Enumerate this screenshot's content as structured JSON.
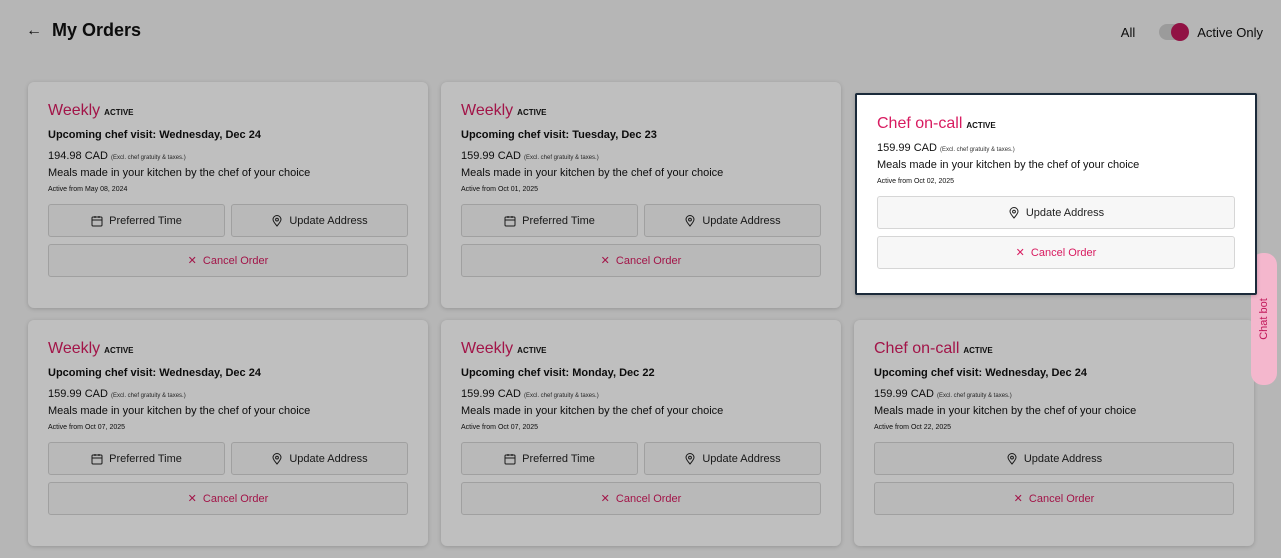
{
  "header": {
    "back_icon": "arrow-left-icon",
    "title": "My Orders"
  },
  "filter": {
    "all_label": "All",
    "active_only_label": "Active Only"
  },
  "orders": [
    {
      "plan": "Weekly",
      "badge": "ACTIVE",
      "visit": "Upcoming chef visit: Wednesday, Dec 24",
      "price": "194.98 CAD",
      "excl": "(Excl. chef gratuity & taxes.)",
      "desc": "Meals made in your kitchen by the chef of your choice",
      "since": "Active from May 08, 2024",
      "preferred_time": "Preferred Time",
      "update_address": "Update Address",
      "cancel": "Cancel Order"
    },
    {
      "plan": "Weekly",
      "badge": "ACTIVE",
      "visit": "Upcoming chef visit: Tuesday, Dec 23",
      "price": "159.99 CAD",
      "excl": "(Excl. chef gratuity & taxes.)",
      "desc": "Meals made in your kitchen by the chef of your choice",
      "since": "Active from Oct 01, 2025",
      "preferred_time": "Preferred Time",
      "update_address": "Update Address",
      "cancel": "Cancel Order"
    },
    {
      "plan": "Chef on-call",
      "badge": "ACTIVE",
      "price": "159.99 CAD",
      "excl": "(Excl. chef gratuity & taxes.)",
      "desc": "Meals made in your kitchen by the chef of your choice",
      "since": "Active from Oct 02, 2025",
      "update_address": "Update Address",
      "cancel": "Cancel Order"
    },
    {
      "plan": "Weekly",
      "badge": "ACTIVE",
      "visit": "Upcoming chef visit: Wednesday, Dec 24",
      "price": "159.99 CAD",
      "excl": "(Excl. chef gratuity & taxes.)",
      "desc": "Meals made in your kitchen by the chef of your choice",
      "since": "Active from Oct 07, 2025",
      "preferred_time": "Preferred Time",
      "update_address": "Update Address",
      "cancel": "Cancel Order"
    },
    {
      "plan": "Weekly",
      "badge": "ACTIVE",
      "visit": "Upcoming chef visit: Monday, Dec 22",
      "price": "159.99 CAD",
      "excl": "(Excl. chef gratuity & taxes.)",
      "desc": "Meals made in your kitchen by the chef of your choice",
      "since": "Active from Oct 07, 2025",
      "preferred_time": "Preferred Time",
      "update_address": "Update Address",
      "cancel": "Cancel Order"
    },
    {
      "plan": "Chef on-call",
      "badge": "ACTIVE",
      "visit": "Upcoming chef visit: Wednesday, Dec 24",
      "price": "159.99 CAD",
      "excl": "(Excl. chef gratuity & taxes.)",
      "desc": "Meals made in your kitchen by the chef of your choice",
      "since": "Active from Oct 22, 2025",
      "update_address": "Update Address",
      "cancel": "Cancel Order"
    }
  ],
  "chatbot": {
    "label": "Chat bot"
  },
  "colors": {
    "accent": "#d81b60",
    "overlay": "rgba(0,0,0,0.25)"
  }
}
